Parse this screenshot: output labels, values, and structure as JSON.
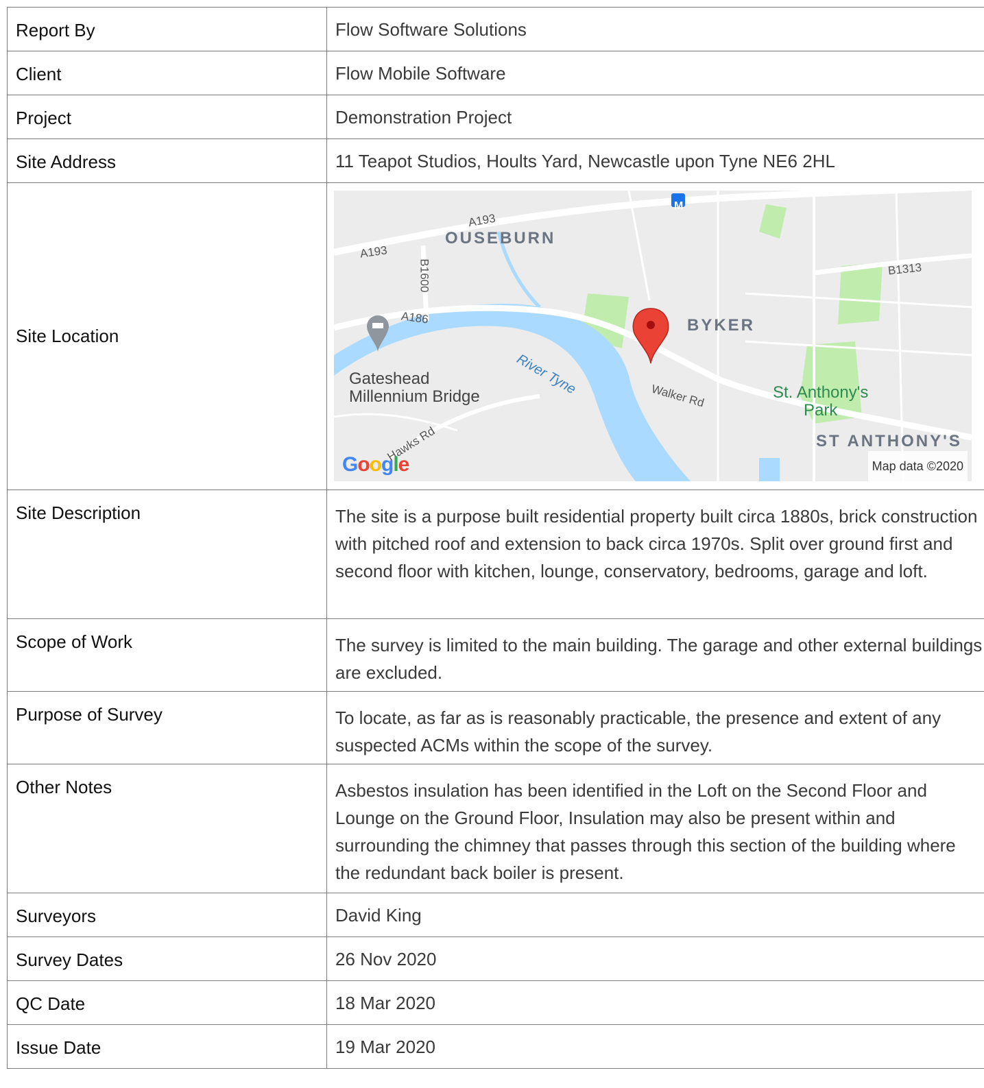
{
  "rows": [
    {
      "label": "Report By",
      "value": "Flow Software Solutions"
    },
    {
      "label": "Client",
      "value": "Flow Mobile Software"
    },
    {
      "label": "Project",
      "value": "Demonstration Project"
    },
    {
      "label": "Site Address",
      "value": "11 Teapot Studios, Hoults Yard, Newcastle upon Tyne NE6 2HL"
    },
    {
      "label": "Site Location"
    },
    {
      "label": "Site Description",
      "value": "The site is a purpose built residential property built circa 1880s, brick construction with pitched roof and extension to back circa 1970s. Split over ground first and second floor with kitchen, lounge, conservatory, bedrooms, garage and loft."
    },
    {
      "label": "Scope of Work",
      "value": "The survey is limited to the main building. The garage and other external buildings are excluded."
    },
    {
      "label": "Purpose of Survey",
      "value": "To locate, as far as is reasonably practicable, the presence and extent of any suspected ACMs within the scope of the survey."
    },
    {
      "label": "Other Notes",
      "value": "Asbestos insulation has been identified in the Loft on the Second Floor and Lounge on the Ground Floor, Insulation may also be present within and surrounding the chimney that passes through this section of the building where the redundant back boiler is present."
    },
    {
      "label": "Surveyors",
      "value": "David King"
    },
    {
      "label": "Survey Dates",
      "value": "26 Nov 2020"
    },
    {
      "label": "QC Date",
      "value": "18 Mar 2020"
    },
    {
      "label": "Issue Date",
      "value": "19 Mar 2020"
    }
  ],
  "map": {
    "labels": {
      "ouseburn": "OUSEBURN",
      "byker": "BYKER",
      "st_anthonys": "ST ANTHONY'S",
      "a193_a": "A193",
      "a193_b": "A193",
      "b1600": "B1600",
      "a186": "A186",
      "b1313": "B1313",
      "walker_rd": "Walker Rd",
      "hawks_rd": "Hawks Rd",
      "river_tyne": "River Tyne",
      "bridge_line1": "Gateshead",
      "bridge_line2": "Millennium Bridge",
      "park_line1": "St. Anthony's",
      "park_line2": "Park",
      "metro": "M"
    },
    "google_letters": [
      "G",
      "o",
      "o",
      "g",
      "l",
      "e"
    ],
    "google_colors": [
      "#4285F4",
      "#EA4335",
      "#FBBC05",
      "#4285F4",
      "#34A853",
      "#EA4335"
    ],
    "credit": "Map data ©2020",
    "colors": {
      "land": "#ececec",
      "water": "#aadaff",
      "park": "#c0ecae",
      "road": "#ffffff",
      "pin": "#ea4335"
    }
  }
}
